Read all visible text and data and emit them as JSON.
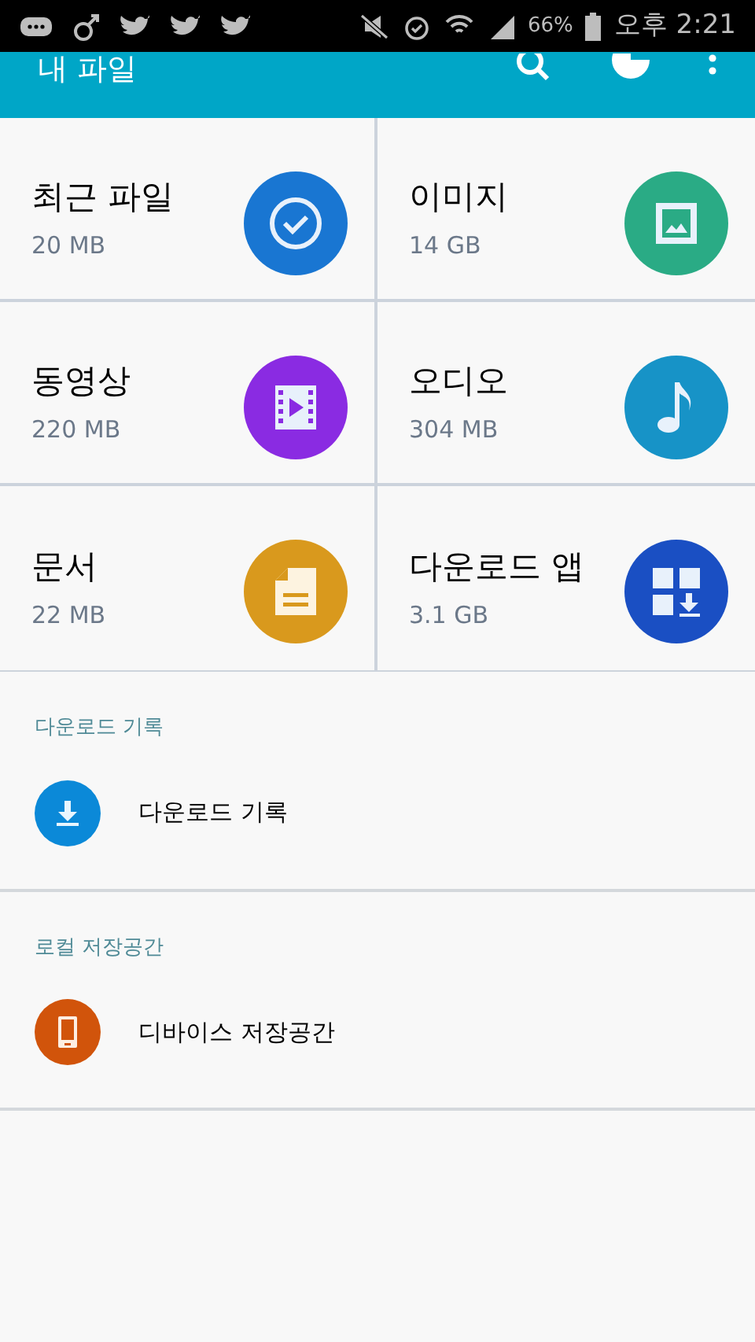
{
  "status_bar": {
    "battery": "66%",
    "time": "오후 2:21"
  },
  "app_bar": {
    "title": "내 파일"
  },
  "categories": [
    {
      "kind": "recent",
      "name": "최근 파일",
      "size": "20 MB",
      "color": "#1976d2"
    },
    {
      "kind": "image",
      "name": "이미지",
      "size": "14 GB",
      "color": "#2aab85"
    },
    {
      "kind": "video",
      "name": "동영상",
      "size": "220 MB",
      "color": "#8a2be2"
    },
    {
      "kind": "audio",
      "name": "오디오",
      "size": "304 MB",
      "color": "#1793c7"
    },
    {
      "kind": "document",
      "name": "문서",
      "size": "22 MB",
      "color": "#d9991d"
    },
    {
      "kind": "apps",
      "name": "다운로드 앱",
      "size": "3.1 GB",
      "color": "#1a4fc3"
    }
  ],
  "sections": [
    {
      "header": "다운로드 기록",
      "items": [
        {
          "kind": "download",
          "label": "다운로드 기록",
          "color": "#0b89d8"
        }
      ]
    },
    {
      "header": "로컬 저장공간",
      "items": [
        {
          "kind": "device",
          "label": "디바이스 저장공간",
          "color": "#d1540b"
        }
      ]
    }
  ]
}
